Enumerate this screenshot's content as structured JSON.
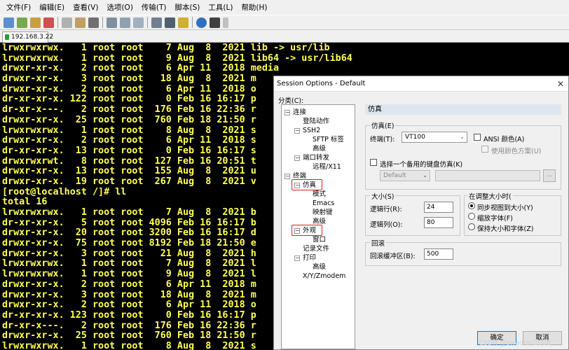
{
  "menubar": {
    "items": [
      "文件(F)",
      "编辑(E)",
      "查看(V)",
      "选项(O)",
      "传输(T)",
      "脚本(S)",
      "工具(L)",
      "帮助(H)"
    ]
  },
  "tab": {
    "label": "192.168.3.22"
  },
  "terminal": {
    "lines": [
      "lrwxrwxrwx.   1 root root    7 Aug  8  2021 lib -> usr/lib",
      "lrwxrwxrwx.   1 root root    9 Aug  8  2021 lib64 -> usr/lib64",
      "drwxr-xr-x.   2 root root    6 Apr 11  2018 media",
      "drwxr-xr-x.   3 root root   18 Aug  8  2021 m",
      "drwxr-xr-x.   2 root root    6 Apr 11  2018 o",
      "dr-xr-xr-x. 122 root root    0 Feb 16 16:17 p",
      "dr-xr-x---.   2 root root  176 Feb 16 22:36 r",
      "drwxr-xr-x.  25 root root  760 Feb 18 21:50 r",
      "lrwxrwxrwx.   1 root root    8 Aug  8  2021 s",
      "drwxr-xr-x.   2 root root    6 Apr 11  2018 s",
      "dr-xr-xr-x.  13 root root    0 Feb 16 16:17 s",
      "drwxrwxrwt.   8 root root  127 Feb 16 20:51 t",
      "drwxr-xr-x.  13 root root  155 Aug  8  2021 u",
      "drwxr-xr-x.  19 root root  267 Aug  8  2021 v",
      "[root@localhost /]# ll",
      "total 16",
      "lrwxrwxrwx.   1 root root    7 Aug  8  2021 b",
      "dr-xr-xr-x.   5 root root 4096 Feb 16 16:17 b",
      "drwxr-xr-x.  20 root root 3200 Feb 16 16:17 d",
      "drwxr-xr-x.  75 root root 8192 Feb 18 21:50 e",
      "drwxr-xr-x.   3 root root   21 Aug  8  2021 h",
      "lrwxrwxrwx.   1 root root    7 Aug  8  2021 l",
      "lrwxrwxrwx.   1 root root    9 Aug  8  2021 l",
      "drwxr-xr-x.   2 root root    6 Apr 11  2018 m",
      "drwxr-xr-x.   3 root root   18 Aug  8  2021 m",
      "drwxr-xr-x.   2 root root    6 Apr 11  2018 o",
      "dr-xr-xr-x. 123 root root    0 Feb 16 16:17 p",
      "dr-xr-x---.   2 root root  176 Feb 16 22:36 r",
      "drwxr-xr-x.  25 root root  760 Feb 18 21:50 r",
      "lrwxrwxrwx.   1 root root    8 Aug  8  2021 s"
    ]
  },
  "dialog": {
    "title": "Session Options - Default",
    "close_glyph": "✕",
    "category_label": "分类(C):",
    "tree": {
      "connection": "连接",
      "login_actions": "登陆动作",
      "ssh2": "SSH2",
      "sftp_tab": "SFTP 标签",
      "advanced_ssh2": "高级",
      "port_forwarding": "端口转发",
      "remote_x11": "远程/X11",
      "terminal": "终端",
      "emulation": "仿真",
      "modes": "模式",
      "emacs": "Emacs",
      "mapped_keys": "映射键",
      "advanced_emulation": "高级",
      "appearance": "外观",
      "window": "窗口",
      "log_file": "记录文件",
      "printing": "打印",
      "advanced_printing": "高级",
      "xyzmodem": "X/Y/Zmodem"
    },
    "section_title": "仿真",
    "emulation_group": {
      "title": "仿真(E)",
      "terminal_label": "终端(T):",
      "terminal_value": "VT100",
      "ansi_color": "ANSI 颜色(A)",
      "use_color_scheme": "使用颜色方案(U)",
      "alt_keyboard": "选择一个备用的键盘仿真(K)",
      "alt_keyboard_value": "Default",
      "browse_label": "..."
    },
    "size_group": {
      "title": "大小(S)",
      "rows_label": "逻辑行(R):",
      "rows_value": "24",
      "cols_label": "逻辑列(O):",
      "cols_value": "80"
    },
    "resize_group": {
      "title": "在调整大小时(",
      "sync_view": "同步视图到大小(Y)",
      "scale_font": "缩放字体(F)",
      "keep_size_font": "保持大小和字体(Z)"
    },
    "scroll_group": {
      "title": "回滚",
      "buffer_label": "回滚缓冲区(B):",
      "buffer_value": "500"
    },
    "ok_label": "确定",
    "cancel_label": "取消"
  },
  "watermark": "CSDN @swadian2008",
  "colors": {
    "terminal_text": "#ffff55",
    "terminal_bg": "#000000",
    "highlight_box": "#e02020",
    "section_header_bg": "#dde6f0"
  }
}
